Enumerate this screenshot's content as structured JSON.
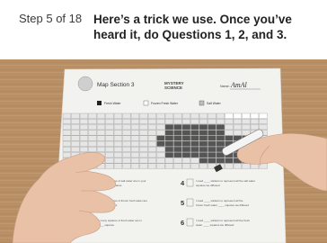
{
  "header": {
    "step": "Step 5 of 18",
    "instruction": "Here’s a trick we use. Once you’ve heard it, do Questions 1, 2, and 3."
  },
  "worksheet": {
    "title": "Map Section 3",
    "brand_line1": "MYSTERY",
    "brand_line2": "SCIENCE",
    "name_label": "Name:",
    "name_value": "AmAl",
    "legend": [
      "Fresh Water",
      "Frozen Fresh Water",
      "Salt Water"
    ],
    "questions": [
      {
        "number": "1",
        "line1": "Figure out how many squares of salt water are in your",
        "line2": "section of the map: ____ squares"
      },
      {
        "number": "2",
        "line1": "Figure out how many squares of frozen fresh water are",
        "line2": "in your section: ____ squares"
      },
      {
        "number": "3",
        "line1": "Figure out how many squares of fresh water are in",
        "line2": "your section: ____ squares"
      },
      {
        "number": "4",
        "line1": "I used ____ stickers to represent all the salt water",
        "line2": "squares we diffused"
      },
      {
        "number": "5",
        "line1": "I used ____ stickers to represent all the",
        "line2": "frozen fresh water ____ squares we diffused"
      },
      {
        "number": "6",
        "line1": "I used ____ stickers to represent all the fresh",
        "line2": "water ____ squares we diffused"
      }
    ]
  },
  "colors": {
    "table": "#b88e63",
    "paper": "#f2f2ef",
    "ink": "#333333",
    "skin": "#e9c1a6",
    "cell_dark": "#555555",
    "cell_light": "#e6e6e6"
  }
}
